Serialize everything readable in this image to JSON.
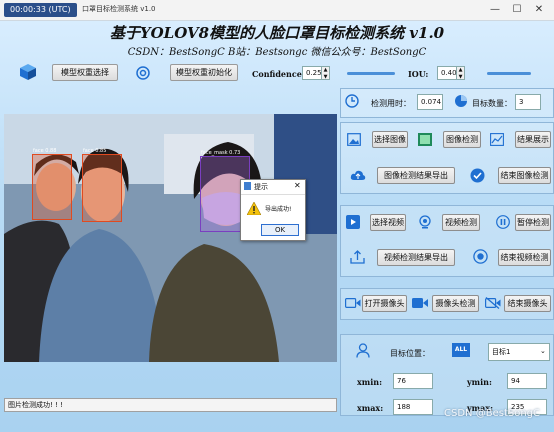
{
  "window": {
    "clock": "00:00:33 (UTC)",
    "title": "口罩目标检测系统 v1.0",
    "controls": {
      "minimize": "—",
      "maximize": "☐",
      "close": "✕"
    }
  },
  "header": {
    "title": "基于YOLOV8模型的人脸口罩目标检测系统 v1.0",
    "subtitle": "CSDN：BestSongC   B站：Bestsongc   微信公众号：BestSongC"
  },
  "toolbar": {
    "select_weights": "模型权重选择",
    "init_weights": "模型权重初始化",
    "confidence_label": "Confidence:",
    "confidence_value": "0.25",
    "confidence_level": 0.25,
    "iou_label": "IOU:",
    "iou_value": "0.40",
    "iou_level": 0.4
  },
  "detections": [
    {
      "label": "face 0.88"
    },
    {
      "label": "face 0.85"
    },
    {
      "label": "face_mask 0.73"
    }
  ],
  "dialog": {
    "title": "提示",
    "message": "导出成功!",
    "ok": "OK",
    "close": "✕"
  },
  "stats": {
    "time_label": "检测用时：",
    "time_value": "0.074",
    "count_label": "目标数量：",
    "count_value": "3"
  },
  "image_section": {
    "select_image": "选择图像",
    "detect_image": "图像检测",
    "show_result": "结果展示",
    "export_image": "图像检测结果导出",
    "end_image": "结束图像检测"
  },
  "video_section": {
    "select_video": "选择视频",
    "detect_video": "视频检测",
    "pause_detect": "暂停检测",
    "export_video": "视频检测结果导出",
    "end_video": "结束视频检测"
  },
  "camera_section": {
    "open_camera": "打开摄像头",
    "detect_camera": "摄像头检测",
    "end_camera": "结束摄像头"
  },
  "target": {
    "position_label": "目标位置：",
    "all_badge": "ALL",
    "select_value": "目标1",
    "xmin_label": "xmin:",
    "xmin_value": "76",
    "ymin_label": "ymin:",
    "ymin_value": "94",
    "xmax_label": "xmax:",
    "xmax_value": "188",
    "ymax_label": "ymax:",
    "ymax_value": "235"
  },
  "status": "图片检测成功! ! !",
  "watermark": "CSDN @BestSongC",
  "colors": {
    "accent": "#1f6fd1",
    "face_box": "#e04a20",
    "mask_box": "#7a3fc0"
  }
}
